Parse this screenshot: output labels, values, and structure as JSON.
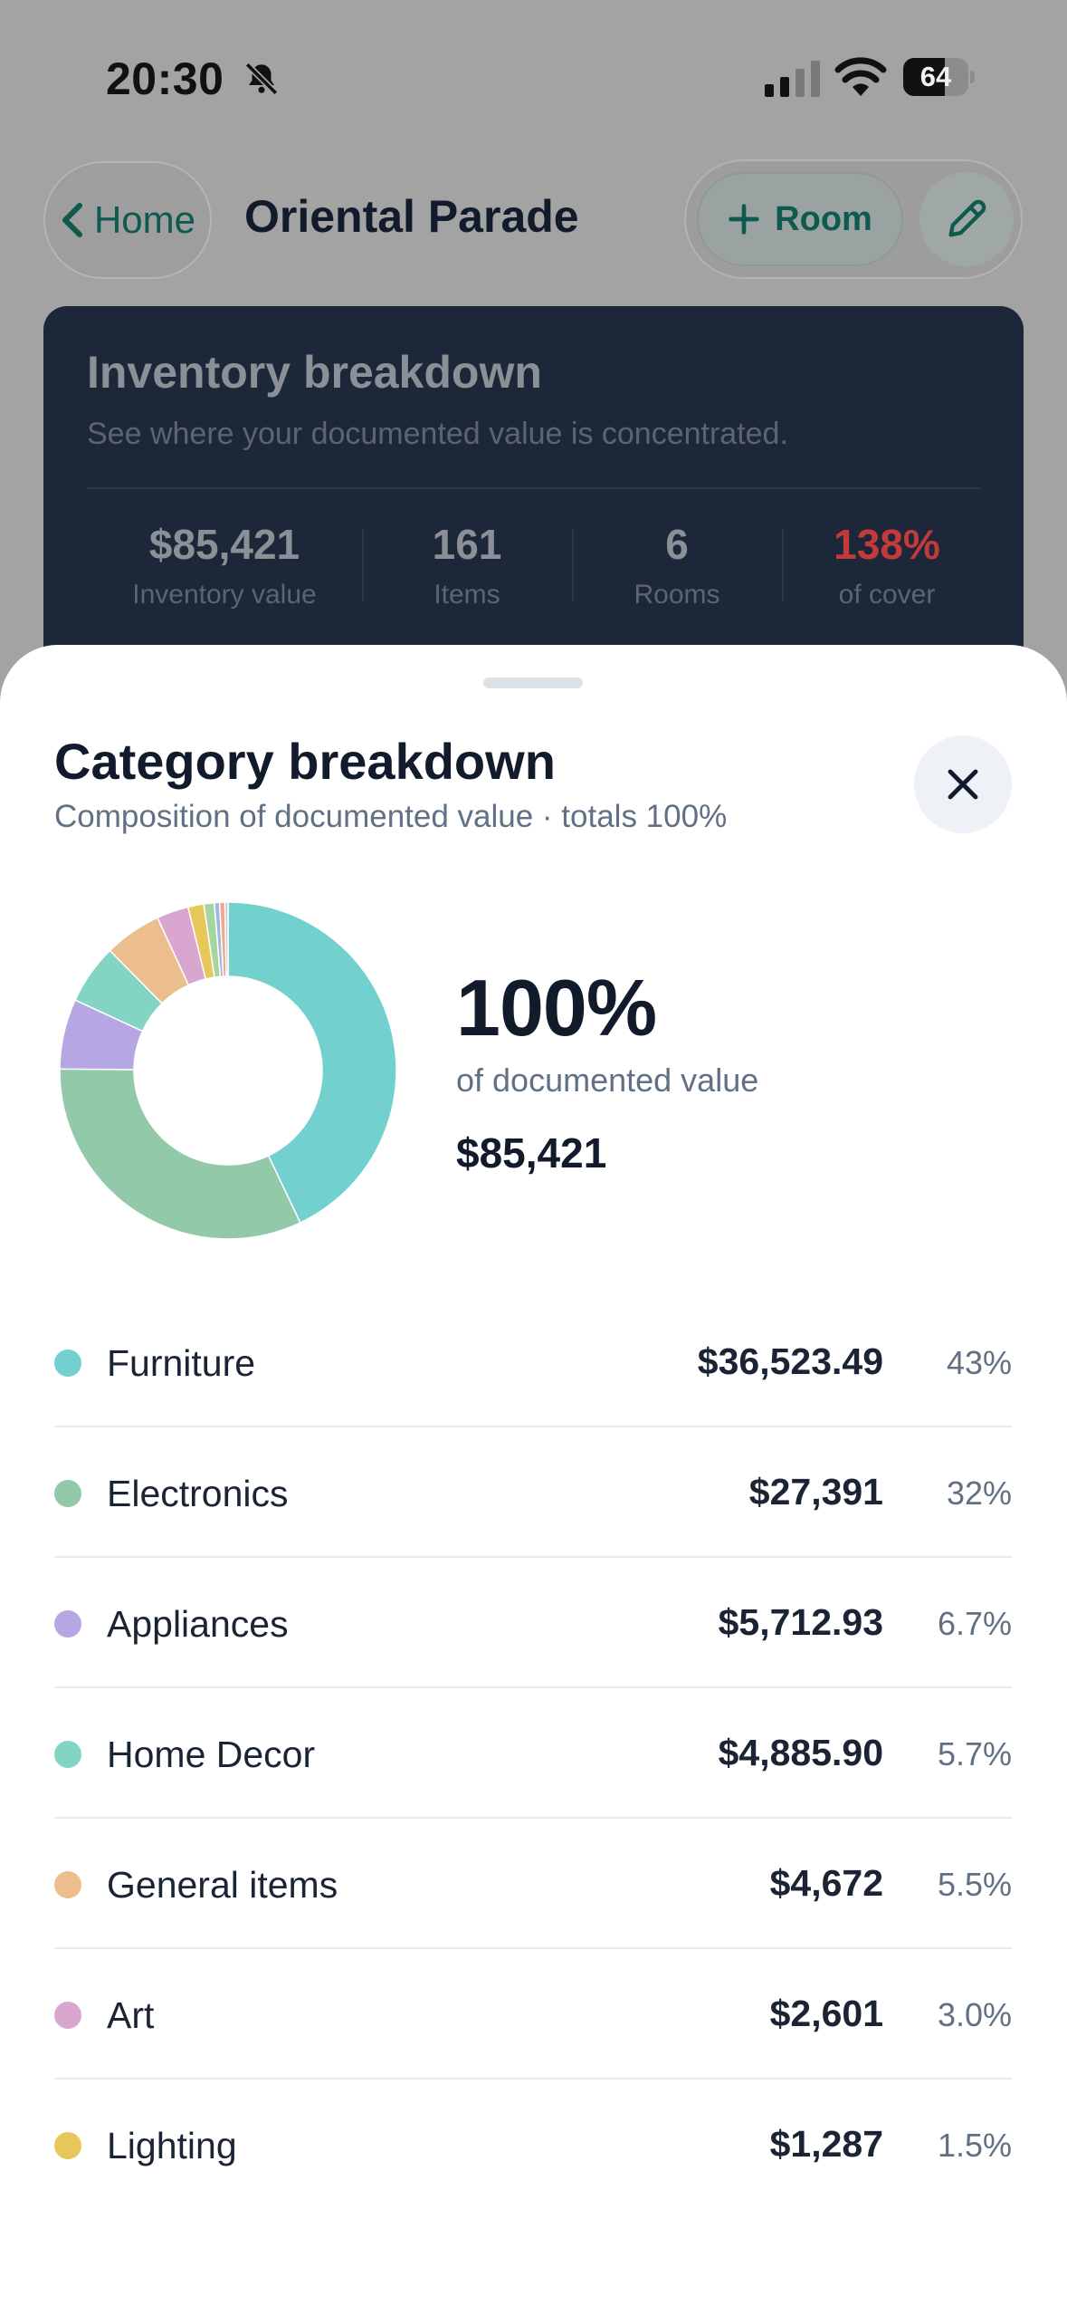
{
  "status_bar": {
    "time": "20:30",
    "battery_text": "64",
    "battery_level": 0.64
  },
  "header": {
    "back_label": "Home",
    "title": "Oriental Parade",
    "room_button_label": "Room"
  },
  "summary": {
    "title": "Inventory breakdown",
    "subtitle": "See where your documented value is concentrated.",
    "stats": [
      {
        "value": "$85,421",
        "label": "Inventory value",
        "color": "#8b8f96"
      },
      {
        "value": "161",
        "label": "Items",
        "color": "#8b8f96"
      },
      {
        "value": "6",
        "label": "Rooms",
        "color": "#8b8f96"
      },
      {
        "value": "138%",
        "label": "of cover",
        "color": "#c43a3a"
      }
    ]
  },
  "sheet": {
    "title": "Category breakdown",
    "subtitle": "Composition of documented value · totals 100%",
    "percent": "100%",
    "percent_caption": "of documented value",
    "total_value": "$85,421"
  },
  "categories": [
    {
      "name": "Furniture",
      "value": "$36,523.49",
      "percent": "43%",
      "share": 42.76,
      "color": "#72d0cf"
    },
    {
      "name": "Electronics",
      "value": "$27,391",
      "percent": "32%",
      "share": 32.07,
      "color": "#92c9a8"
    },
    {
      "name": "Appliances",
      "value": "$5,712.93",
      "percent": "6.7%",
      "share": 6.69,
      "color": "#b7a6e4"
    },
    {
      "name": "Home Decor",
      "value": "$4,885.90",
      "percent": "5.7%",
      "share": 5.72,
      "color": "#84d4c4"
    },
    {
      "name": "General items",
      "value": "$4,672",
      "percent": "5.5%",
      "share": 5.47,
      "color": "#ecbd8d"
    },
    {
      "name": "Art",
      "value": "$2,601",
      "percent": "3.0%",
      "share": 3.05,
      "color": "#d9a6cf"
    },
    {
      "name": "Lighting",
      "value": "$1,287",
      "percent": "1.5%",
      "share": 1.51,
      "color": "#e8c75a"
    }
  ],
  "donut_extra_slices": [
    {
      "share": 1.0,
      "color": "#a6d69f"
    },
    {
      "share": 0.5,
      "color": "#9fb8e0"
    },
    {
      "share": 0.5,
      "color": "#f0a88c"
    },
    {
      "share": 0.3,
      "color": "#c9c9d6"
    }
  ],
  "icons": {
    "back": "chevron-left-icon",
    "bell": "bell-slash-icon",
    "signal": "cell-signal-icon",
    "wifi": "wifi-icon",
    "room_add": "plus-icon",
    "edit": "pencil-icon",
    "close": "close-icon"
  }
}
